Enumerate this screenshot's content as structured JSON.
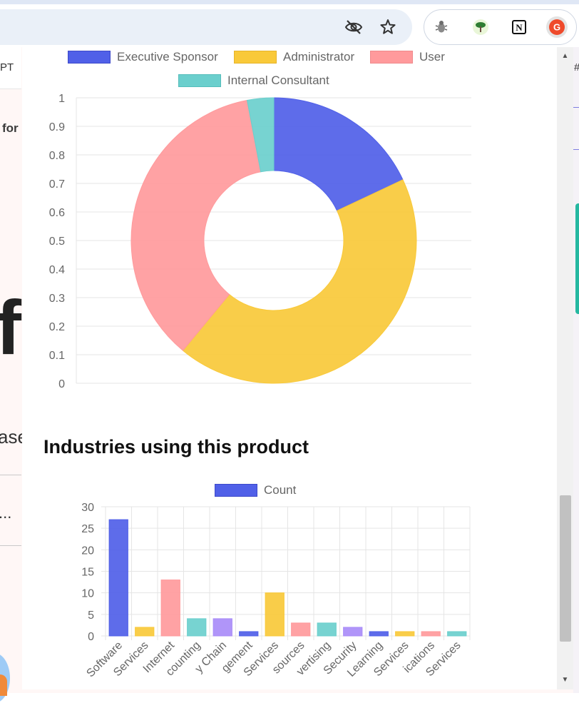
{
  "browser": {
    "icons": {
      "hide": "eye-off-icon",
      "bookmark": "star-icon",
      "ext1": "bug-extension-icon",
      "ext2": "tree-extension-icon",
      "ext3": "notion-icon",
      "ext4": "g2-icon"
    },
    "ext_labels": {
      "notion": "N",
      "g2": "G"
    }
  },
  "background_page": {
    "tab_fragment": "PT",
    "bold_fragment": "for",
    "big_fragment": "fo",
    "text_fragment": "ase",
    "ellipsis": "...",
    "right_fragment": "#"
  },
  "colors": {
    "blue": "#5060e8",
    "yellow": "#f9c939",
    "pink": "#ff9a9c",
    "teal": "#6bcfcd",
    "purple": "#a98cf8",
    "brand_red": "#ef4a2b"
  },
  "roles_chart_data": {
    "type": "pie",
    "legend": [
      "Executive Sponsor",
      "Administrator",
      "User",
      "Internal Consultant"
    ],
    "values": [
      0.18,
      0.43,
      0.36,
      0.03
    ],
    "colors": [
      "#5060e8",
      "#f9c939",
      "#ff9a9c",
      "#6bcfcd"
    ],
    "y_ticks": [
      "1",
      "0.9",
      "0.8",
      "0.7",
      "0.6",
      "0.5",
      "0.4",
      "0.3",
      "0.2",
      "0.1",
      "0"
    ]
  },
  "industries": {
    "title": "Industries using this product"
  },
  "chart_data": {
    "type": "bar",
    "legend": "Count",
    "categories": [
      "Software",
      "Services",
      "Internet",
      "counting",
      "y Chain",
      "gement",
      "Services",
      "sources",
      "vertising",
      "Security",
      "Learning",
      "Services",
      "ications",
      "Services"
    ],
    "values": [
      27,
      2,
      13,
      4,
      4,
      1,
      10,
      3,
      3,
      2,
      1,
      1,
      1,
      1
    ],
    "colors": [
      "#5060e8",
      "#f9c939",
      "#ff9a9c",
      "#6bcfcd",
      "#a98cf8",
      "#5060e8",
      "#f9c939",
      "#ff9a9c",
      "#6bcfcd",
      "#a98cf8",
      "#5060e8",
      "#f9c939",
      "#ff9a9c",
      "#6bcfcd"
    ],
    "y_ticks": [
      "30",
      "25",
      "20",
      "15",
      "10",
      "5",
      "0"
    ],
    "ylim": [
      0,
      30
    ]
  }
}
